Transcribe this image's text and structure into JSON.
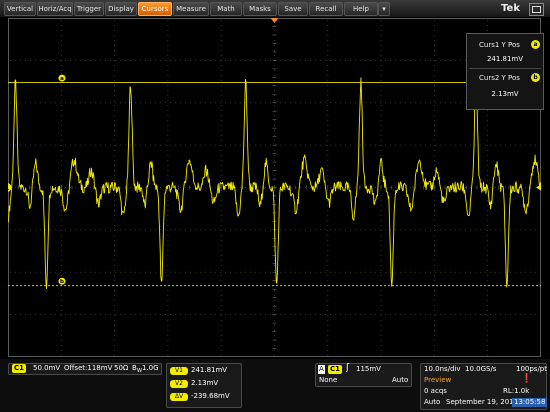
{
  "menubar": {
    "items": [
      {
        "label": "Vertical"
      },
      {
        "label": "Horiz/Acq"
      },
      {
        "label": "Trigger"
      },
      {
        "label": "Display"
      },
      {
        "label": "Cursors",
        "active": true
      },
      {
        "label": "Measure"
      },
      {
        "label": "Math"
      },
      {
        "label": "Masks"
      },
      {
        "label": "Save"
      },
      {
        "label": "Recall"
      },
      {
        "label": "Help"
      }
    ],
    "brand": "Tek"
  },
  "colors": {
    "accent_orange": "#ff8c1a",
    "trace_yellow": "#f2ec00",
    "background": "#000000"
  },
  "cursor_readout": {
    "curs1_label": "Curs1 Y Pos",
    "curs1_badge": "a",
    "curs1_value": "241.81mV",
    "curs2_label": "Curs2 Y Pos",
    "curs2_badge": "b",
    "curs2_value": "2.13mV"
  },
  "plot_markers": {
    "channel_marker": "1",
    "cursor_a_marker": "a",
    "cursor_b_marker": "b",
    "trigger_marker_icon": "trigger-position-icon"
  },
  "channel_panel": {
    "channel": "C1",
    "scale": "50.0mV",
    "offset": "Offset:118mV",
    "impedance": "50Ω",
    "bandwidth": "1.0G",
    "bandwidth_prefix": "B",
    "bandwidth_sub": "W"
  },
  "cursor_values": {
    "v1_tag": "V1",
    "v1": "241.81mV",
    "v2_tag": "V2",
    "v2": "2.13mV",
    "dv_tag": "ΔV",
    "dv": "-239.68mV"
  },
  "trigger_panel": {
    "mode_letter": "A",
    "channel": "C1",
    "slope_icon": "rising-edge-icon",
    "level": "115mV",
    "coupling": "None",
    "mode": "Auto"
  },
  "acq_panel": {
    "timebase": "10.0ns/div",
    "sample_rate": "10.0GS/s",
    "resolution": "100ps/pt",
    "status": "Preview",
    "acqs": "0 acqs",
    "record_length": "RL:1.0k",
    "run_mode": "Auto",
    "date": "September 19, 2014",
    "time": "13:05:58",
    "status_icon": "exclamation-icon"
  },
  "waveform": {
    "period_ns": 21.6,
    "first_peak_ns": 1.4,
    "peak_mV": 241.81,
    "trough_mV": 2.13,
    "baseline_mV": 118,
    "time_span_ns": 100
  }
}
